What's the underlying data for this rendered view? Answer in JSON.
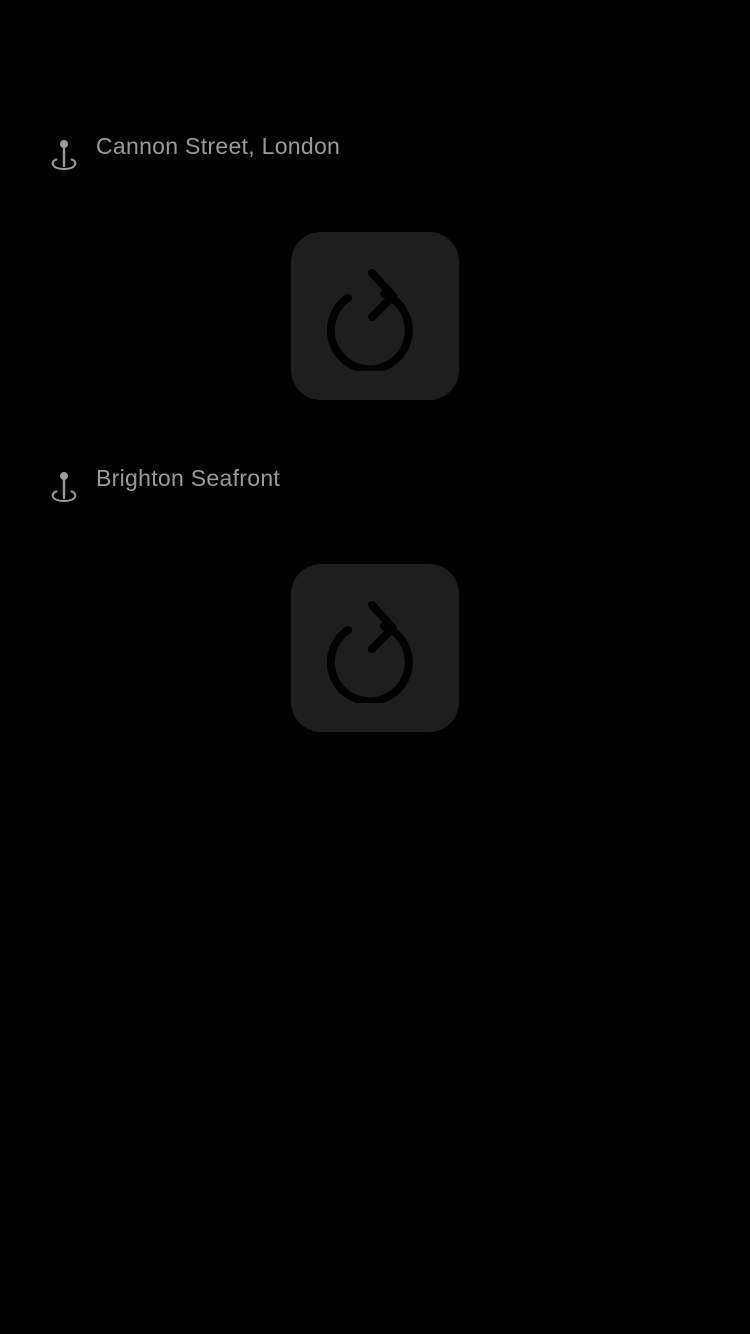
{
  "colors": {
    "background": "#000000",
    "label": "#9a9a9a",
    "pin": "#9a9a9a",
    "tile": "#1e1e1e",
    "reload_glyph": "#000000"
  },
  "locations": [
    {
      "label": "Cannon Street, London",
      "icon": "map-pin-icon",
      "action_icon": "reload-icon"
    },
    {
      "label": "Brighton Seafront",
      "icon": "map-pin-icon",
      "action_icon": "reload-icon"
    }
  ]
}
